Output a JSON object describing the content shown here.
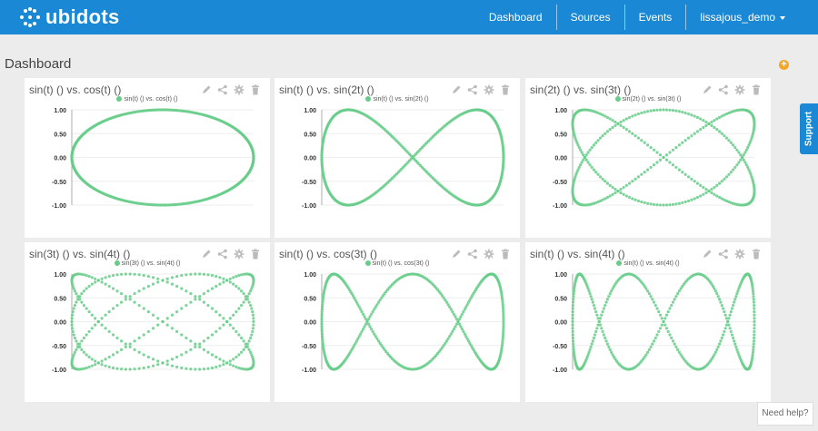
{
  "app": {
    "logo_text": "ubidots"
  },
  "nav": {
    "dashboard": "Dashboard",
    "sources": "Sources",
    "events": "Events",
    "user": "lissajous_demo"
  },
  "page": {
    "title": "Dashboard",
    "add_label": "+"
  },
  "colors": {
    "accent": "#1a88d4",
    "series": "#66cc88",
    "add": "#f5a623"
  },
  "widget_icons": [
    "pencil-icon",
    "share-icon",
    "gear-icon",
    "trash-icon"
  ],
  "ticks": [
    "1.00",
    "0.50",
    "0.00",
    "-0.50",
    "-1.00"
  ],
  "widgets": [
    {
      "title": "sin(t) () vs. cos(t) ()",
      "legend": "sin(t) () vs. cos(t) ()"
    },
    {
      "title": "sin(t) () vs. sin(2t) ()",
      "legend": "sin(t) () vs. sin(2t) ()"
    },
    {
      "title": "sin(2t) () vs. sin(3t) ()",
      "legend": "sin(2t) () vs. sin(3t) ()"
    },
    {
      "title": "sin(3t) () vs. sin(4t) ()",
      "legend": "sin(3t) () vs. sin(4t) ()"
    },
    {
      "title": "sin(t) () vs. cos(3t) ()",
      "legend": "sin(t) () vs. cos(3t) ()"
    },
    {
      "title": "sin(t) () vs. sin(4t) ()",
      "legend": "sin(t) () vs. sin(4t) ()"
    }
  ],
  "chart_data": [
    {
      "type": "scatter",
      "series": [
        {
          "name": "sin(t) () vs. cos(t) ()",
          "x_freq": 1,
          "y_freq": 1,
          "y_phase": "cos"
        }
      ],
      "ylim": [
        -1,
        1
      ],
      "xlim": [
        -1,
        1
      ]
    },
    {
      "type": "scatter",
      "series": [
        {
          "name": "sin(t) () vs. sin(2t) ()",
          "x_freq": 1,
          "y_freq": 2,
          "y_phase": "sin"
        }
      ],
      "ylim": [
        -1,
        1
      ],
      "xlim": [
        -1,
        1
      ]
    },
    {
      "type": "scatter",
      "series": [
        {
          "name": "sin(2t) () vs. sin(3t) ()",
          "x_freq": 2,
          "y_freq": 3,
          "y_phase": "sin"
        }
      ],
      "ylim": [
        -1,
        1
      ],
      "xlim": [
        -1,
        1
      ]
    },
    {
      "type": "scatter",
      "series": [
        {
          "name": "sin(3t) () vs. sin(4t) ()",
          "x_freq": 3,
          "y_freq": 4,
          "y_phase": "sin"
        }
      ],
      "ylim": [
        -1,
        1
      ],
      "xlim": [
        -1,
        1
      ]
    },
    {
      "type": "scatter",
      "series": [
        {
          "name": "sin(t) () vs. cos(3t) ()",
          "x_freq": 1,
          "y_freq": 3,
          "y_phase": "cos"
        }
      ],
      "ylim": [
        -1,
        1
      ],
      "xlim": [
        -1,
        1
      ]
    },
    {
      "type": "scatter",
      "series": [
        {
          "name": "sin(t) () vs. sin(4t) ()",
          "x_freq": 1,
          "y_freq": 4,
          "y_phase": "sin"
        }
      ],
      "ylim": [
        -1,
        1
      ],
      "xlim": [
        -1,
        1
      ]
    }
  ],
  "support": {
    "label": "Support"
  },
  "help": {
    "label": "Need help?"
  }
}
